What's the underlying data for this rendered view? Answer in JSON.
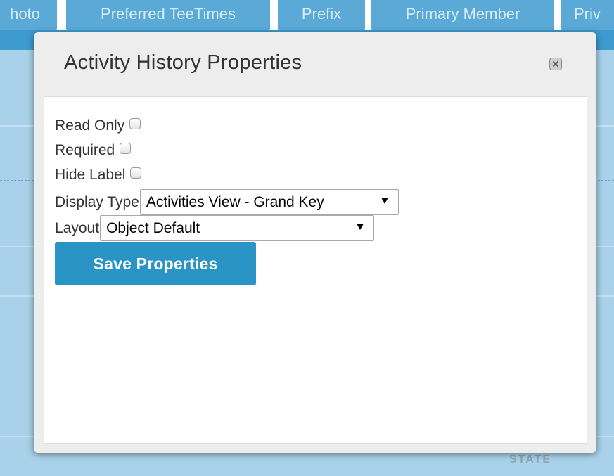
{
  "background": {
    "tabs": [
      "hoto",
      "Preferred TeeTimes",
      "Prefix",
      "Primary Member",
      "Priv"
    ],
    "footer_text": "STATE"
  },
  "modal": {
    "title": "Activity History Properties",
    "close_icon": "close-icon",
    "fields": {
      "read_only": {
        "label": "Read Only",
        "checked": false
      },
      "required": {
        "label": "Required",
        "checked": false
      },
      "hide_label": {
        "label": "Hide Label",
        "checked": false
      },
      "display_type": {
        "label": "Display Type",
        "value": "Activities View - Grand Key"
      },
      "layout": {
        "label": "Layout",
        "value": "Object Default"
      }
    },
    "save_label": "Save Properties"
  },
  "colors": {
    "accent": "#2a94c7",
    "tab_background": "#5aa9d6",
    "page_background": "#a9d2ea",
    "modal_background": "#ededed"
  }
}
